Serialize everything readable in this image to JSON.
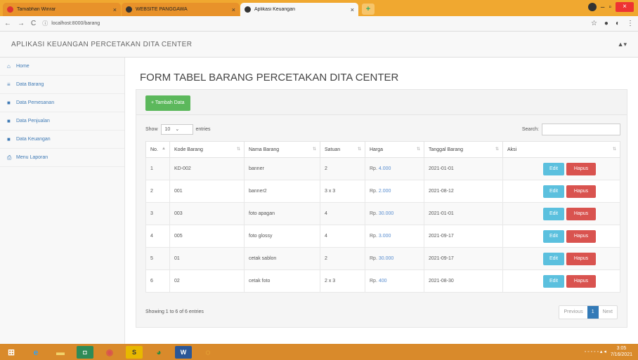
{
  "browser": {
    "tabs": [
      {
        "label": "Tamabhan Winrar",
        "active": false
      },
      {
        "label": "WEBSITE PANGGAWA",
        "active": false
      },
      {
        "label": "Aplikasi Keuangan",
        "active": true
      }
    ],
    "url": "localhost:8000/barang"
  },
  "app": {
    "brand": "APLIKASI KEUANGAN PERCETAKAN DITA CENTER",
    "user_icon": "user-icon"
  },
  "sidebar": {
    "items": [
      {
        "label": "Home",
        "icon": "home-icon"
      },
      {
        "label": "Data Barang",
        "icon": "list-icon"
      },
      {
        "label": "Data Pemesanan",
        "icon": "document-icon"
      },
      {
        "label": "Data Penjualan",
        "icon": "document-icon"
      },
      {
        "label": "Data Keuangan",
        "icon": "document-icon"
      },
      {
        "label": "Menu Laporan",
        "icon": "print-icon"
      }
    ]
  },
  "main": {
    "title": "FORM TABEL BARANG PERCETAKAN DITA CENTER",
    "add_button": "+ Tambah Data",
    "show_label": "Show",
    "show_value": "10",
    "entries_label": "entries",
    "search_label": "Search:",
    "search_value": "",
    "columns": [
      "No.",
      "Kode Barang",
      "Nama Barang",
      "Satuan",
      "Harga",
      "Tanggal Barang",
      "Aksi"
    ],
    "rows": [
      {
        "no": "1",
        "kode": "KD-002",
        "nama": "banner",
        "satuan": "2",
        "currency": "Rp.",
        "harga": "4.000",
        "tanggal": "2021-01-01"
      },
      {
        "no": "2",
        "kode": "001",
        "nama": "banner2",
        "satuan": "3 x 3",
        "currency": "Rp.",
        "harga": "2.000",
        "tanggal": "2021-08-12"
      },
      {
        "no": "3",
        "kode": "003",
        "nama": "foto apagan",
        "satuan": "4",
        "currency": "Rp.",
        "harga": "30.000",
        "tanggal": "2021-01-01"
      },
      {
        "no": "4",
        "kode": "005",
        "nama": "foto glossy",
        "satuan": "4",
        "currency": "Rp.",
        "harga": "3.000",
        "tanggal": "2021-09-17"
      },
      {
        "no": "5",
        "kode": "01",
        "nama": "cetak sablon",
        "satuan": "2",
        "currency": "Rp.",
        "harga": "30.000",
        "tanggal": "2021-09-17"
      },
      {
        "no": "6",
        "kode": "02",
        "nama": "cetak foto",
        "satuan": "2 x 3",
        "currency": "Rp.",
        "harga": "400",
        "tanggal": "2021-08-30"
      }
    ],
    "edit_label": "Edit",
    "delete_label": "Hapus",
    "info": "Showing 1 to 6 of 6 entries",
    "pager": {
      "previous": "Previous",
      "current": "1",
      "next": "Next"
    }
  },
  "taskbar": {
    "clock_time": "3:05",
    "clock_date": "7/16/2021"
  }
}
